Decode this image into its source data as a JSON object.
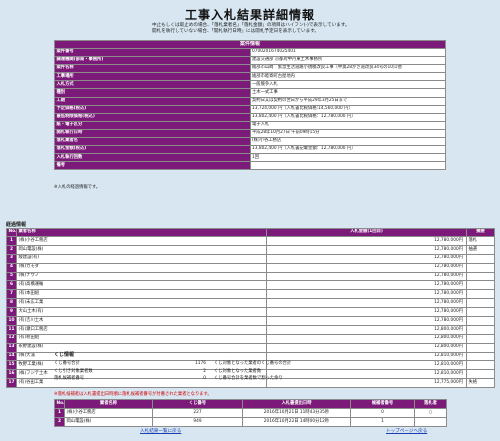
{
  "page_title": "工事入札結果詳細情報",
  "notes": [
    "中止もしくは取止めの場合、「落札業者名」「落札金額」の項目はハイフン(-)で表示しています。",
    "開札を執行していない場合、「開札執行日時」には開札予定日を表示しています。"
  ],
  "info": {
    "header": "案件情報",
    "rows": [
      {
        "label": "案件番号",
        "value": "0700201674025401"
      },
      {
        "label": "調達機関(部局・事務所)",
        "value": "建設交通部 京都府中丹東土木事務所"
      },
      {
        "label": "案件名称",
        "value": "綾部市山崎　緊急生活道路小規模改良工事（中奥28かき道改良34号の10)1他"
      },
      {
        "label": "工事場所",
        "value": "綾部市睦寄町古屋地内"
      },
      {
        "label": "入札方式",
        "value": "一般競争入札"
      },
      {
        "label": "種別",
        "value": "土木一式工事"
      },
      {
        "label": "工期",
        "value": "契約日又は契約の翌日から平成29年3月25日まで"
      },
      {
        "label": "予定価格(税込)",
        "value": "13,724,000 円（入札書比較価格:14,560,000 円）"
      },
      {
        "label": "最低制限価格(税込)",
        "value": "13,802,400 円（入札書比較価格：12,780,000 円）"
      },
      {
        "label": "紙・電子区分",
        "value": "電子入札"
      },
      {
        "label": "開札執行日時",
        "value": "平成28年10月27日 午前09時15分"
      },
      {
        "label": "落札業者名",
        "value": "(株)小谷工務店"
      },
      {
        "label": "落札金額(税込)",
        "value": "13,802,400 円（入札書記載金額：12,780,000 円）"
      },
      {
        "label": "入札執行回数",
        "value": "1回"
      },
      {
        "label": "備考",
        "value": ""
      }
    ]
  },
  "bid_note": "※入札の経過情報です。",
  "results": {
    "title": "経過情報",
    "headers": [
      "No.",
      "業者名称",
      "入札金額(1回目)",
      "摘要"
    ],
    "rows": [
      {
        "no": "1",
        "name": "(株)小谷工務店",
        "amount": "12,780,000円",
        "remark": "落札"
      },
      {
        "no": "2",
        "name": "岡山電設(株)",
        "amount": "12,780,000円",
        "remark": "抽選"
      },
      {
        "no": "3",
        "name": "綾建設(有)",
        "amount": "12,780,000円",
        "remark": ""
      },
      {
        "no": "4",
        "name": "(株)カモダ",
        "amount": "12,780,000円",
        "remark": ""
      },
      {
        "no": "5",
        "name": "(株)ナウノ",
        "amount": "12,780,000円",
        "remark": ""
      },
      {
        "no": "6",
        "name": "(有)高橋運輸",
        "amount": "12,780,000円",
        "remark": ""
      },
      {
        "no": "7",
        "name": "(有)本田組",
        "amount": "12,780,000円",
        "remark": ""
      },
      {
        "no": "8",
        "name": "(有)末広工業",
        "amount": "12,780,000円",
        "remark": ""
      },
      {
        "no": "9",
        "name": "大山土木(有)",
        "amount": "12,780,000円",
        "remark": ""
      },
      {
        "no": "10",
        "name": "(有)吉川土木",
        "amount": "12,780,000円",
        "remark": ""
      },
      {
        "no": "11",
        "name": "(有)瀬口工務店",
        "amount": "12,800,000円",
        "remark": ""
      },
      {
        "no": "12",
        "name": "(有)秋田組",
        "amount": "12,800,000円",
        "remark": ""
      },
      {
        "no": "13",
        "name": "永野建設(株)",
        "amount": "12,800,000円",
        "remark": ""
      },
      {
        "no": "14",
        "name": "(株)大浦",
        "amount": "12,810,000円",
        "remark": ""
      },
      {
        "no": "15",
        "name": "牧野工業(株)",
        "amount": "12,810,000円",
        "remark": ""
      },
      {
        "no": "16",
        "name": "(株)フジテ土木",
        "amount": "12,810,000円",
        "remark": ""
      },
      {
        "no": "17",
        "name": "(有)谷田工業",
        "amount": "12,775,000円",
        "remark": "失格"
      }
    ]
  },
  "kuji": {
    "title": "くじ情報",
    "stats": [
      {
        "label": "くじ番号合計",
        "value": "1176",
        "label2": "くじ対象となった業者のくじ番号の合計",
        "value2": ""
      },
      {
        "label": "くじ引き対象業者数",
        "value": "2",
        "label2": "くじ対象となった業者数",
        "value2": ""
      },
      {
        "label": "落札候補者番号",
        "value": "0",
        "label2": "くじ番号合計を業者数で割った余り",
        "value2": ""
      }
    ],
    "red_note": "※落札候補者は入札書提出日時順に落札候補者番号が付番された業者となります。",
    "headers": [
      "No.",
      "業者名称",
      "くじ番号",
      "入札書提出日時",
      "候補者番号",
      "落札者"
    ],
    "rows": [
      {
        "no": "1",
        "name": "(株)小谷工務店",
        "kuji": "227",
        "datetime": "2016年10月21日 11時43分35秒",
        "cand": "0",
        "win": "○"
      },
      {
        "no": "2",
        "name": "岡山電設(株)",
        "kuji": "949",
        "datetime": "2016年10月22日 14時00分12秒",
        "cand": "1",
        "win": ""
      }
    ]
  },
  "footer": {
    "back_link": "入札結果一覧に戻る",
    "top_link": "トップページへ戻る"
  }
}
